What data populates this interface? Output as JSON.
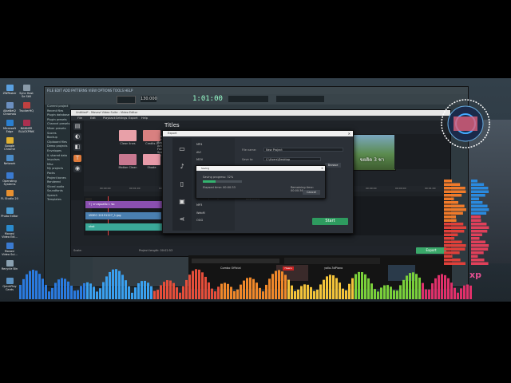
{
  "desktop_icons": [
    {
      "label": "ZWPaster",
      "color": "#5aa0e0"
    },
    {
      "label": "AlbaNet2 ChromeA",
      "color": "#6b8fc0"
    },
    {
      "label": "Microsoft Edge",
      "color": "#2a7fd0"
    },
    {
      "label": "Google Chrome",
      "color": "#e0b030"
    },
    {
      "label": "Network",
      "color": "#4a8bc8"
    },
    {
      "label": "Operating Systems",
      "color": "#3a7ad0"
    },
    {
      "label": "FL Studio 20",
      "color": "#e89030"
    },
    {
      "label": "Photo Editor",
      "color": "#4a9ad0"
    },
    {
      "label": "Movavi Video Edi...",
      "color": "#2a8acd"
    },
    {
      "label": "Movavi Video Sui...",
      "color": "#3a7ad0"
    },
    {
      "label": "Recycle Bin",
      "color": "#8aa0b0"
    },
    {
      "label": "QuickPlay Cards",
      "color": "#5a90c0"
    }
  ],
  "desktop_icons_col2": [
    {
      "label": "Sync Host Se Still",
      "color": "#8a9aa8"
    },
    {
      "label": "TruckerHQ",
      "color": "#c04040"
    },
    {
      "label": "BANNER BLACKPINK",
      "color": "#aa3050"
    }
  ],
  "fl": {
    "menu": "FILE EDIT ADD PATTERNS VIEW OPTIONS TOOLS HELP",
    "time": "1:01:00",
    "tempo": "130.000",
    "browser_items": [
      "Current project",
      "Recent files",
      "Plugin database",
      "Plugin presets",
      "Channel presets",
      "Mixer presets",
      "Scores",
      "Backup",
      "Clipboard files",
      "Demo projects",
      "Envelopes",
      "IL shared data",
      "Impulses",
      "Misc",
      "My projects",
      "Packs",
      "Project bones",
      "Rendered",
      "Sliced audio",
      "Soundfonts",
      "Speech",
      "Templates"
    ]
  },
  "movavi": {
    "title": "Untitled* - Movavi Video Suite - Video Editor",
    "menu": [
      "File",
      "Edit",
      "Playback",
      "Settings",
      "Export",
      "Help"
    ],
    "tools": [
      "import-icon",
      "filter-icon",
      "transition-icon",
      "title-icon",
      "stickers-icon"
    ],
    "titles_header": "Titles",
    "categories": [
      "All",
      "Favorites",
      "Purchased",
      "Basic",
      "Artistic",
      "Fonts",
      "Speech bubbles",
      "My titles"
    ],
    "thumbs": [
      {
        "caption": "Clean lines",
        "color": "#e8a0a8"
      },
      {
        "caption": "Credits 1",
        "color": "#d88080"
      },
      {
        "caption": "Frame Outline",
        "color": "#e88aa0"
      },
      {
        "caption": "",
        "color": "#d06a78"
      },
      {
        "caption": "Motion Clean",
        "color": "#c87890"
      },
      {
        "caption": "Shade",
        "color": "#e79aa8"
      },
      {
        "caption": "Text with line 2",
        "color": "#d8808e"
      }
    ],
    "preview_text": "ขยติด 3 ชา",
    "tracks": [
      {
        "label": "T | ทางพุณสมัย 1 ช่อ",
        "color": "#8a4fb0"
      },
      {
        "label": "VIDEO 20191227_1.jpg",
        "color": "#4a7fb0"
      },
      {
        "label": "shot",
        "color": "#3aa898"
      }
    ],
    "scale_label": "Scale:",
    "project_length": "Project length: 00:02:53",
    "export_label": "Export"
  },
  "export_dialog": {
    "title": "Export",
    "formats": [
      "MP4",
      "AVI",
      "MOV",
      "MKV",
      "WMV",
      "FLV",
      "WEBM",
      "MPEG-2 (H.264)",
      "MP3",
      "WebM",
      "OGG"
    ],
    "file_name_label": "File name:",
    "file_name_value": "New Project",
    "save_to_label": "Save to:",
    "save_to_value": "C:\\Users\\Desktop",
    "browse_label": "Browse",
    "advanced_label": "Advanced",
    "start_label": "Start"
  },
  "progress_dialog": {
    "title": "Saving",
    "status": "Saving progress:",
    "percent_text": "32%",
    "progress": 0.32,
    "elapsed_label": "Elapsed time:",
    "elapsed_value": "00:00:33",
    "remaining_label": "Remaining time:",
    "remaining_value": "00:00:36",
    "cancel_label": "Cancel"
  },
  "browser": {
    "items": [
      {
        "text": "Combo Official"
      },
      {
        "text": "yallo.3dPiano"
      },
      {
        "text": "Heera"
      }
    ]
  },
  "watermark": "xp"
}
